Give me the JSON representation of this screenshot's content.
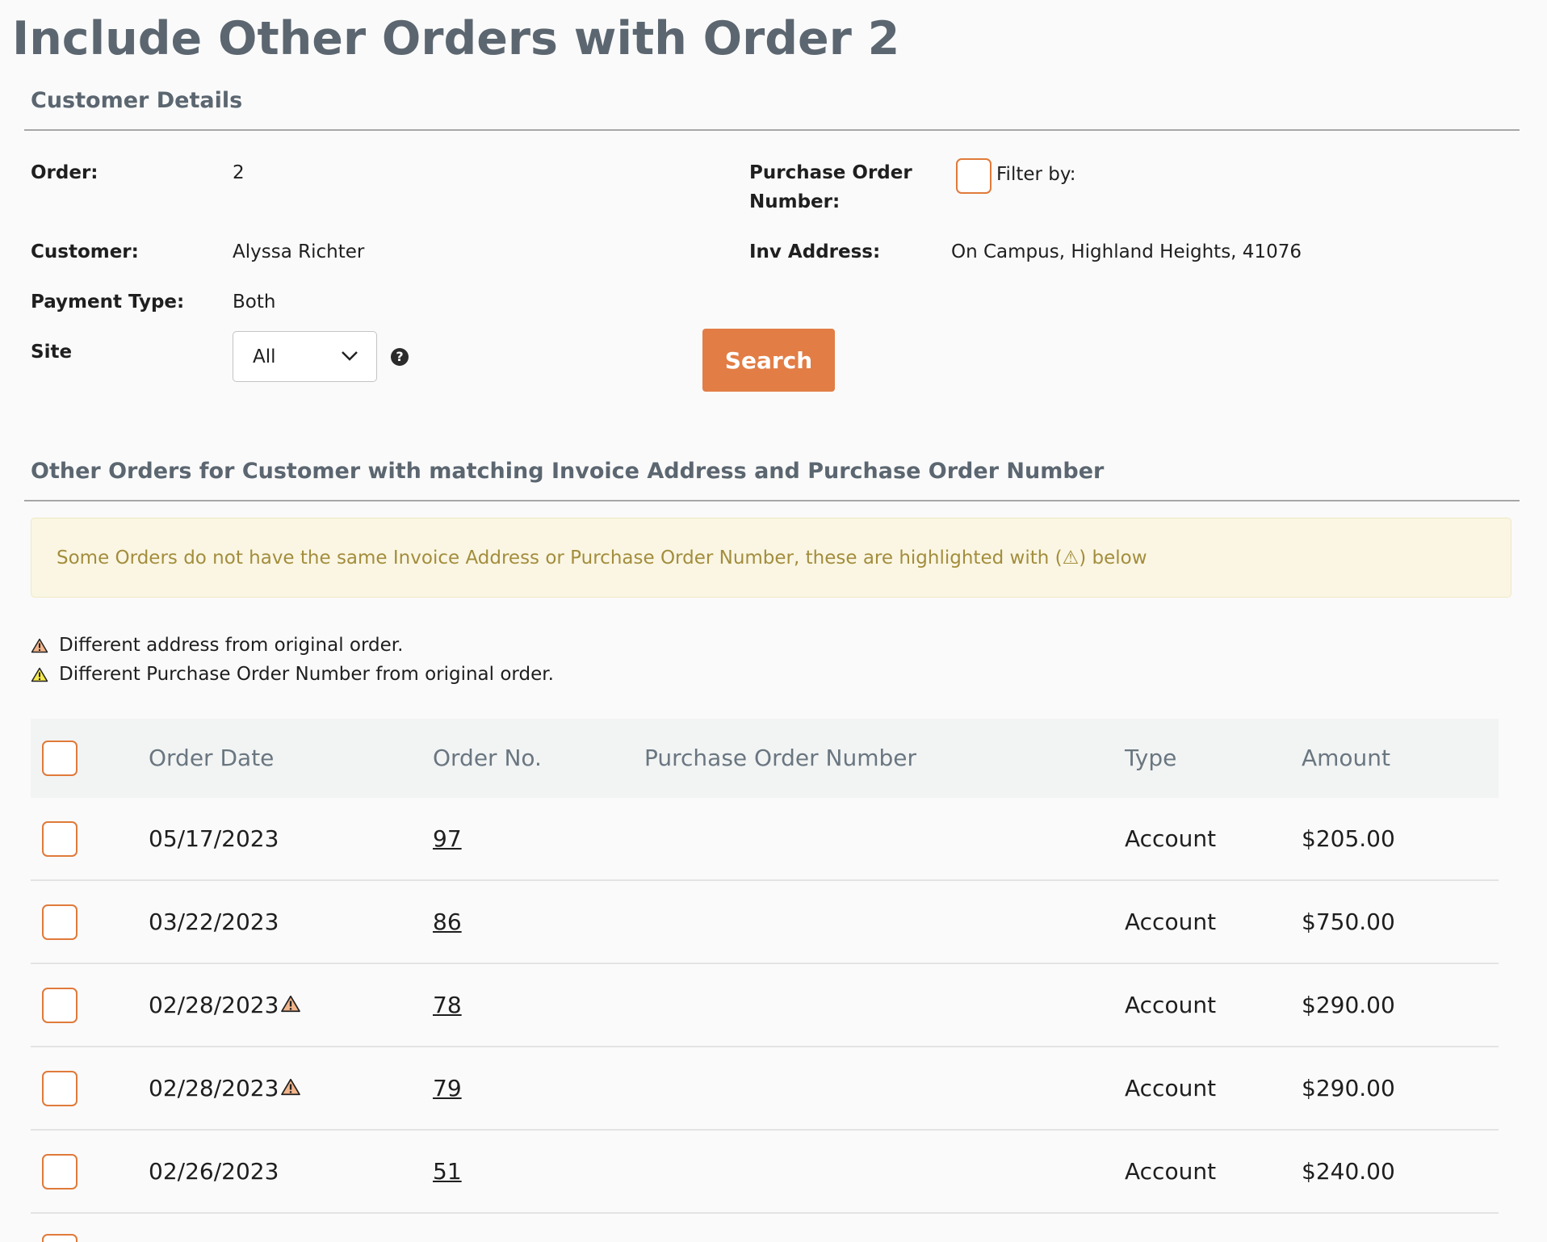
{
  "page": {
    "title": "Include Other Orders with Order 2"
  },
  "customer_details": {
    "heading": "Customer Details",
    "order_label": "Order:",
    "order_value": "2",
    "po_label": "Purchase Order Number:",
    "filter_label": "Filter by:",
    "customer_label": "Customer:",
    "customer_value": "Alyssa Richter",
    "inv_address_label": "Inv Address:",
    "inv_address_value": "On Campus, Highland Heights, 41076",
    "payment_type_label": "Payment Type:",
    "payment_type_value": "Both",
    "site_label": "Site",
    "site_value": "All",
    "search_label": "Search"
  },
  "other_orders": {
    "heading": "Other Orders for Customer with matching Invoice Address and Purchase Order Number",
    "notice": "Some Orders do not have the same Invoice Address or Purchase Order Number, these are highlighted with (⚠) below",
    "legend": {
      "address": "Different address from original order.",
      "po": "Different Purchase Order Number from original order."
    },
    "columns": {
      "date": "Order Date",
      "order_no": "Order No.",
      "po_number": "Purchase Order Number",
      "type": "Type",
      "amount": "Amount"
    },
    "rows": [
      {
        "date": "05/17/2023",
        "address_warning": false,
        "order_no": "97",
        "po_number": "",
        "type": "Account",
        "amount": "$205.00"
      },
      {
        "date": "03/22/2023",
        "address_warning": false,
        "order_no": "86",
        "po_number": "",
        "type": "Account",
        "amount": "$750.00"
      },
      {
        "date": "02/28/2023",
        "address_warning": true,
        "order_no": "78",
        "po_number": "",
        "type": "Account",
        "amount": "$290.00"
      },
      {
        "date": "02/28/2023",
        "address_warning": true,
        "order_no": "79",
        "po_number": "",
        "type": "Account",
        "amount": "$290.00"
      },
      {
        "date": "02/26/2023",
        "address_warning": false,
        "order_no": "51",
        "po_number": "",
        "type": "Account",
        "amount": "$240.00"
      }
    ]
  },
  "colors": {
    "accent": "#e27d45",
    "heading": "#5b6670",
    "notice_text": "#a38d3d",
    "notice_bg": "#faf6e3",
    "address_warning": "#f2b48a",
    "po_warning": "#f5e94a"
  }
}
